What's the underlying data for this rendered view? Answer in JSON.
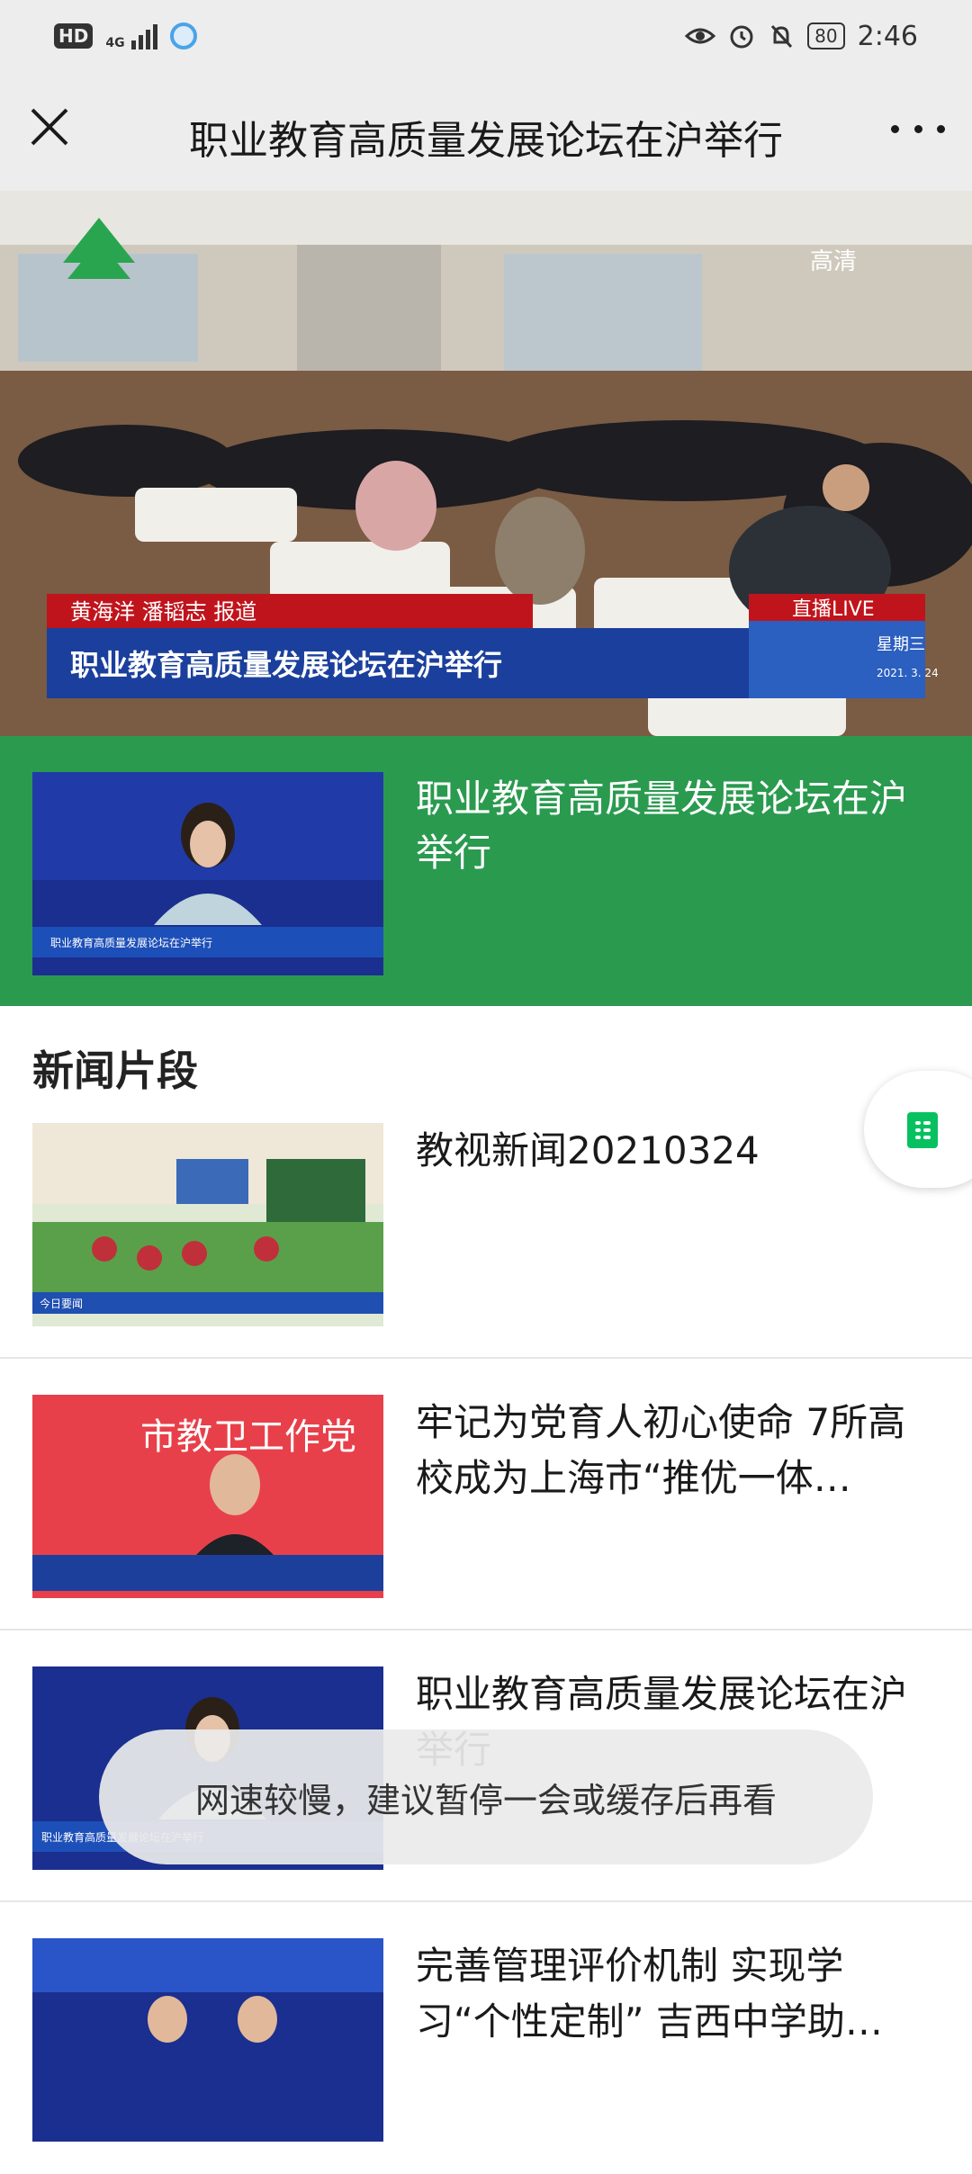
{
  "status_bar": {
    "hd": "HD",
    "network": "4G",
    "battery": "80",
    "time": "2:46"
  },
  "header": {
    "title": "职业教育高质量发展论坛在沪举行"
  },
  "hero": {
    "reporters": "黄海洋  潘韬志   报道",
    "live_label": "直播LIVE",
    "headline": "职业教育高质量发展论坛在沪举行",
    "weekday": "星期三",
    "date": "2021. 3. 24",
    "hd_tag": "高清"
  },
  "featured": {
    "title": "职业教育高质量发展论坛在沪举行",
    "thumb_caption": "职业教育高质量发展论坛在沪举行"
  },
  "section": {
    "title": "新闻片段"
  },
  "news": [
    {
      "title": "教视新闻20210324",
      "thumb_text": "今日要闻"
    },
    {
      "title": "牢记为党育人初心使命 7所高校成为上海市“推优一体…",
      "thumb_text": "市教卫工作党"
    },
    {
      "title": "职业教育高质量发展论坛在沪举行",
      "thumb_text": "职业教育高质量发展论坛在沪举行"
    },
    {
      "title": "完善管理评价机制 实现学习“个性定制”  吉西中学助…",
      "thumb_text": ""
    }
  ],
  "toast": {
    "message": "网速较慢，建议暂停一会或缓存后再看"
  },
  "colors": {
    "brand_green": "#2a9a4f",
    "wechat_green": "#07c160",
    "bar_bg": "#ededed"
  }
}
